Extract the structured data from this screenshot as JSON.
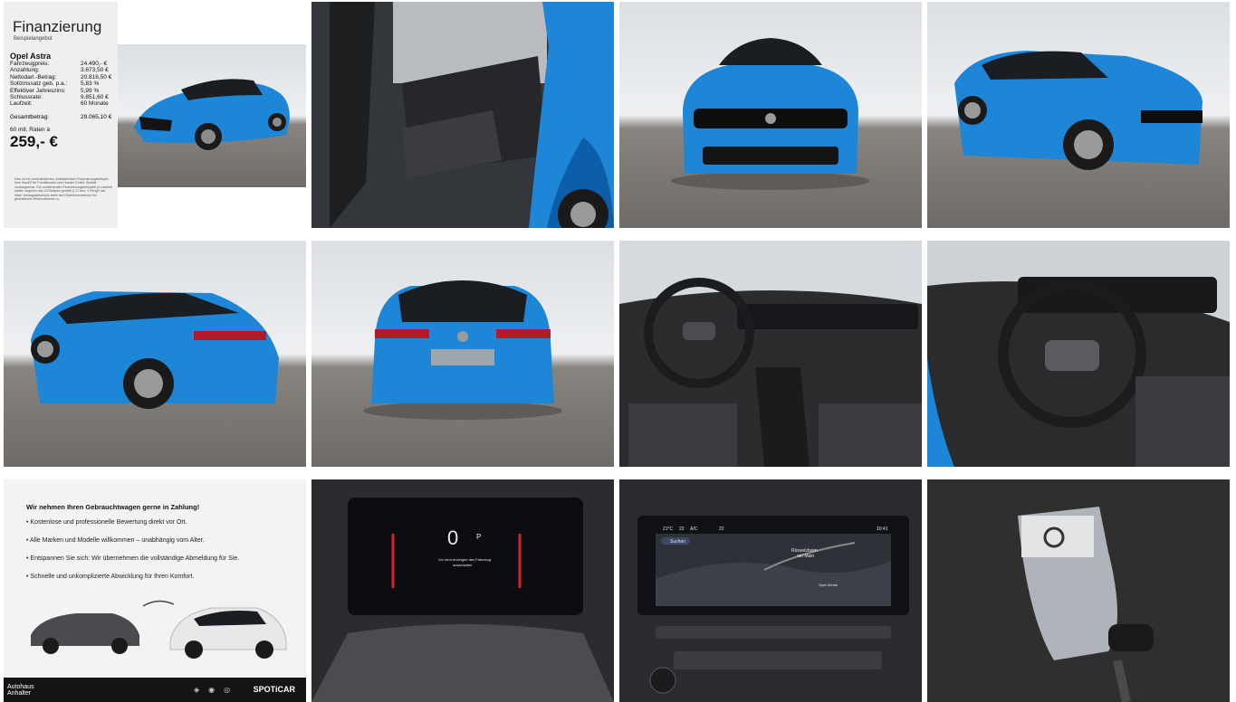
{
  "finance": {
    "title": "Finanzierung",
    "subtitle": "Beispielangebot",
    "model": "Opel Astra",
    "rows": [
      {
        "label": "Fahrzeugpreis:",
        "value": "24.490,- €"
      },
      {
        "label": "Anzahlung:",
        "value": "3.673,50 €"
      },
      {
        "label": "Nettodarl.-Betrag:",
        "value": "20.816,50 €"
      },
      {
        "label": "Sollzinssatz geb. p.a.:",
        "value": "5,83 %"
      },
      {
        "label": "Effektiver Jahreszins:",
        "value": "5,99 %"
      },
      {
        "label": "Schlussrate:",
        "value": "9.851,60 €"
      },
      {
        "label": "Laufzeit:",
        "value": "60 Monate"
      }
    ],
    "total_label": "Gesamtbetrag:",
    "total_value": "29.065,10 €",
    "rate_label": "60 mtl. Raten à",
    "rate_value": "259,- €",
    "disclaimer": "Dies ist ein unverbindliches, freibleibendes Finanzierungsbeispiel Ihrer Bank® für Privatkunden und Handel GmbH. Bonität vorausgesetzt. Die vorstehenden Finanzierungsbeispiele je Laufzeit stellen zugleich das 2/3 Beispiel gemäß § 17 Abs. 4 PAngV dar. Nach Vertragsabschluss steht dem Darlehensnehmer ein gesetzliches Widerrufsrecht zu."
  },
  "tradein": {
    "title": "Wir nehmen Ihren Gebrauchtwagen gerne in Zahlung!",
    "items": [
      "Kostenlose und professionelle Bewertung direkt vor Ort.",
      "Alle Marken und Modelle willkommen – unabhängig vom Alter.",
      "Entspannen Sie sich: Wir übernehmen die vollständige Abmeldung für Sie.",
      "Schnelle und unkomplizierte Abwicklung für Ihren Komfort."
    ],
    "dealer_line1": "Autohaus",
    "dealer_line2": "Anhalter",
    "spoticar": "SPOTiCAR"
  },
  "cluster": {
    "speed": "0",
    "gear": "P",
    "message_line1": "Vor dem Anzeigen des Fahrzeug",
    "message_line2": "ausschalten"
  },
  "infotainment": {
    "temp": "21°C",
    "fan": "22",
    "ac": "A/C",
    "temp_right": "22",
    "time": "10:41",
    "search": "Suchen",
    "city": "Rüsselsheim",
    "city_sub": "am Main",
    "place1": "Opel-Werke"
  },
  "colors": {
    "car_blue": "#1d86d6",
    "car_blue_dark": "#0d5ea8",
    "interior": "#2a2b2d"
  }
}
